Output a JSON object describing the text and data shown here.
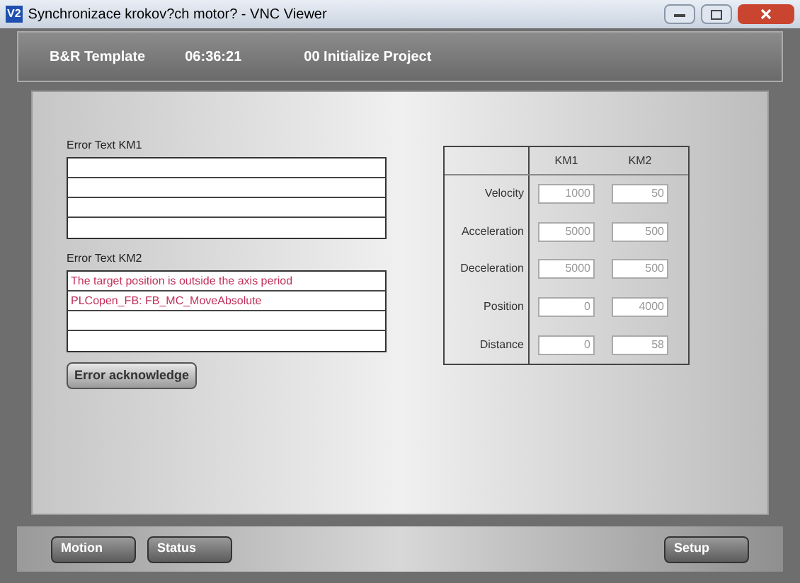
{
  "window": {
    "title": "Synchronizace krokov?ch motor? - VNC Viewer",
    "app_icon": "V2"
  },
  "header": {
    "project": "B&R Template",
    "time": "06:36:21",
    "page": "00 Initialize Project"
  },
  "error_lists": [
    {
      "label": "Error Text KM1"
    },
    {
      "label": "Error Text KM2",
      "lines": [
        "The target position is outside the axis period",
        "PLCopen_FB: FB_MC_MoveAbsolute"
      ]
    }
  ],
  "ack_button": "Error acknowledge",
  "parameters": {
    "columns": [
      "KM1",
      "KM2"
    ],
    "rows": [
      {
        "label": "Velocity",
        "values": [
          "1000",
          "50"
        ]
      },
      {
        "label": "Acceleration",
        "values": [
          "5000",
          "500"
        ]
      },
      {
        "label": "Deceleration",
        "values": [
          "5000",
          "500"
        ]
      },
      {
        "label": "Position",
        "values": [
          "0",
          "4000"
        ]
      },
      {
        "label": "Distance",
        "values": [
          "0",
          "58"
        ]
      }
    ]
  },
  "nav_buttons_left": [
    "Motion",
    "Status"
  ],
  "nav_buttons_right": [
    "Setup"
  ]
}
